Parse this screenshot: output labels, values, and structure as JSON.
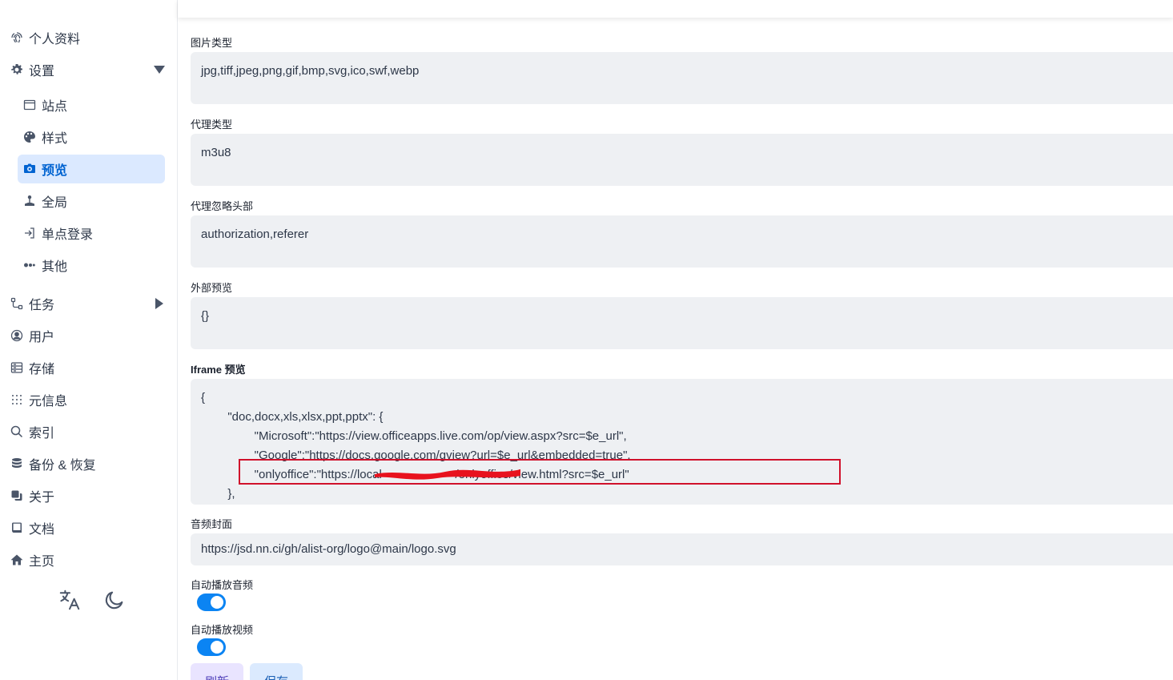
{
  "sidebar": {
    "items": [
      {
        "label": "个人资料",
        "icon": "fingerprint-icon"
      },
      {
        "label": "设置",
        "icon": "gear-icon",
        "expanded": true
      },
      {
        "label": "任务",
        "icon": "workflow-icon",
        "expanded": false
      },
      {
        "label": "用户",
        "icon": "user-circle-icon"
      },
      {
        "label": "存储",
        "icon": "database-icon"
      },
      {
        "label": "元信息",
        "icon": "dots-grid-icon"
      },
      {
        "label": "索引",
        "icon": "search-icon"
      },
      {
        "label": "备份 & 恢复",
        "icon": "stack-icon"
      },
      {
        "label": "关于",
        "icon": "copy-icon"
      },
      {
        "label": "文档",
        "icon": "book-icon"
      },
      {
        "label": "主页",
        "icon": "home-icon"
      }
    ],
    "settings_children": [
      {
        "label": "站点",
        "icon": "window-icon"
      },
      {
        "label": "样式",
        "icon": "palette-icon"
      },
      {
        "label": "预览",
        "icon": "camera-icon",
        "active": true
      },
      {
        "label": "全局",
        "icon": "joystick-icon"
      },
      {
        "label": "单点登录",
        "icon": "login-icon"
      },
      {
        "label": "其他",
        "icon": "dots-icon"
      }
    ],
    "tools": {
      "language_icon": "translate-icon",
      "theme_icon": "moon-icon"
    }
  },
  "form": {
    "image_types": {
      "label": "图片类型",
      "value": "jpg,tiff,jpeg,png,gif,bmp,svg,ico,swf,webp"
    },
    "proxy_types": {
      "label": "代理类型",
      "value": "m3u8"
    },
    "proxy_ignore_headers": {
      "label": "代理忽略头部",
      "value": "authorization,referer"
    },
    "external_previews": {
      "label": "外部预览",
      "value": "{}"
    },
    "iframe_previews": {
      "label": "Iframe 预览",
      "value": "{\n        \"doc,docx,xls,xlsx,ppt,pptx\": {\n                \"Microsoft\":\"https://view.officeapps.live.com/op/view.aspx?src=$e_url\",\n                \"Google\":\"https://docs.google.com/gview?url=$e_url&embedded=true\",\n                \"onlyoffice\":\"https://local                      /onlyoffice/view.html?src=$e_url\"\n        },"
    },
    "audio_cover": {
      "label": "音频封面",
      "value": "https://jsd.nn.ci/gh/alist-org/logo@main/logo.svg"
    },
    "autoplay_audio": {
      "label": "自动播放音频",
      "enabled": true
    },
    "autoplay_video": {
      "label": "自动播放视频",
      "enabled": true
    }
  },
  "actions": {
    "refresh_label": "刷新",
    "save_label": "保存"
  },
  "colors": {
    "accent": "#0b84f3",
    "active_bg": "#dbe9ff",
    "highlight": "#d0112b"
  }
}
